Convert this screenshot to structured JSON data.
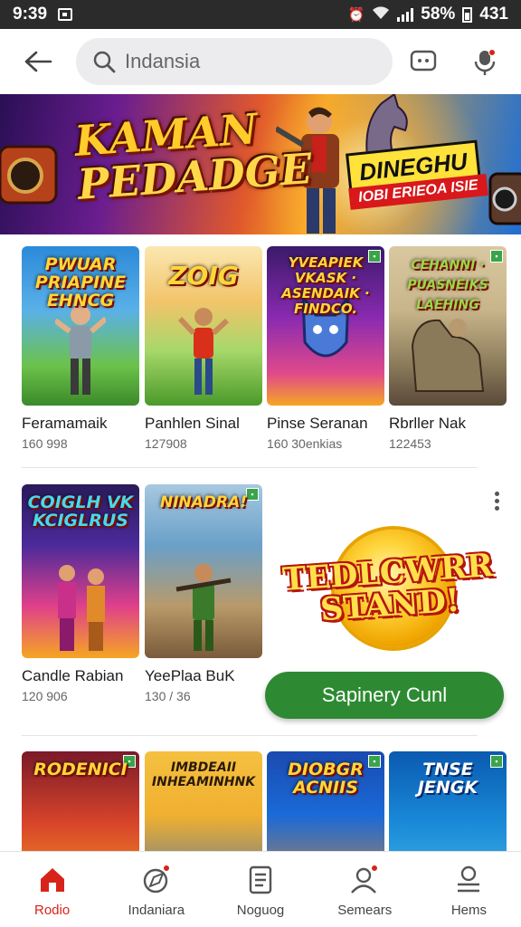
{
  "status_bar": {
    "time": "9:39",
    "battery": "58%",
    "extra": "431"
  },
  "search": {
    "placeholder": "Indansia"
  },
  "banner": {
    "title_line1": "KAMAN",
    "title_line2": "PEDADGE",
    "tag_line1": "DINEGHU",
    "tag_line2": "IOBI ERIEOA ISIE"
  },
  "rows": [
    {
      "items": [
        {
          "logo": "PWUAR PRIAPINE EHNCG",
          "title": "Feramamaik",
          "meta": "160 998",
          "colors": [
            "#2b8ad8",
            "#6cc24a"
          ]
        },
        {
          "logo": "ZOIG",
          "title": "Panhlen Sinal",
          "meta": "127908",
          "colors": [
            "#f2c46a",
            "#6fb53a"
          ]
        },
        {
          "logo": "YVEAPIEK VKASK · ASENDAIK · FINDCO.",
          "title": "Pinse Seranan",
          "meta": "160 30enkias",
          "colors": [
            "#8a2ab0",
            "#e04a8a"
          ]
        },
        {
          "logo": "CEHANNI · PUASNEIKS LAEHING",
          "title": "Rbrller Nak",
          "meta": "122453",
          "colors": [
            "#c9b58a",
            "#6a6a5a"
          ]
        }
      ]
    },
    {
      "items": [
        {
          "logo": "COIGLH VK KCIGLRUS",
          "title": "Candle Rabian",
          "meta": "120 906",
          "colors": [
            "#4b2a9a",
            "#e0408a"
          ]
        },
        {
          "logo": "NINADRA!",
          "title": "YeePlaa BuK",
          "meta": "130 / 36",
          "colors": [
            "#6aa0c8",
            "#7a5a3a"
          ]
        }
      ]
    },
    {
      "items": [
        {
          "logo": "RODENICI",
          "title": "",
          "meta": "",
          "colors": [
            "#d8442a",
            "#f5a623"
          ]
        },
        {
          "logo": "IMBDEAII INHEAMINHNK",
          "title": "",
          "meta": "",
          "colors": [
            "#f0b030",
            "#3a6ab0"
          ]
        },
        {
          "logo": "DIOBGR ACNIIS",
          "title": "",
          "meta": "",
          "colors": [
            "#1a6ad8",
            "#e08a2a"
          ]
        },
        {
          "logo": "TNSE JENGK",
          "title": "",
          "meta": "",
          "colors": [
            "#1a8ad8",
            "#4ac0e8"
          ]
        }
      ]
    }
  ],
  "promo": {
    "headline_line1": "TEDLCWRR",
    "headline_line2": "STAND!",
    "cta_label": "Sapinery Cunl"
  },
  "bottom_nav": [
    {
      "label": "Rodio",
      "icon": "home-icon",
      "active": true
    },
    {
      "label": "Indaniara",
      "icon": "explore-icon",
      "active": false
    },
    {
      "label": "Noguog",
      "icon": "list-icon",
      "active": false
    },
    {
      "label": "Semears",
      "icon": "person-icon",
      "active": false
    },
    {
      "label": "Hems",
      "icon": "account-icon",
      "active": false
    }
  ],
  "colors": {
    "accent_red": "#d8231a",
    "cta_green": "#2d8a32"
  }
}
